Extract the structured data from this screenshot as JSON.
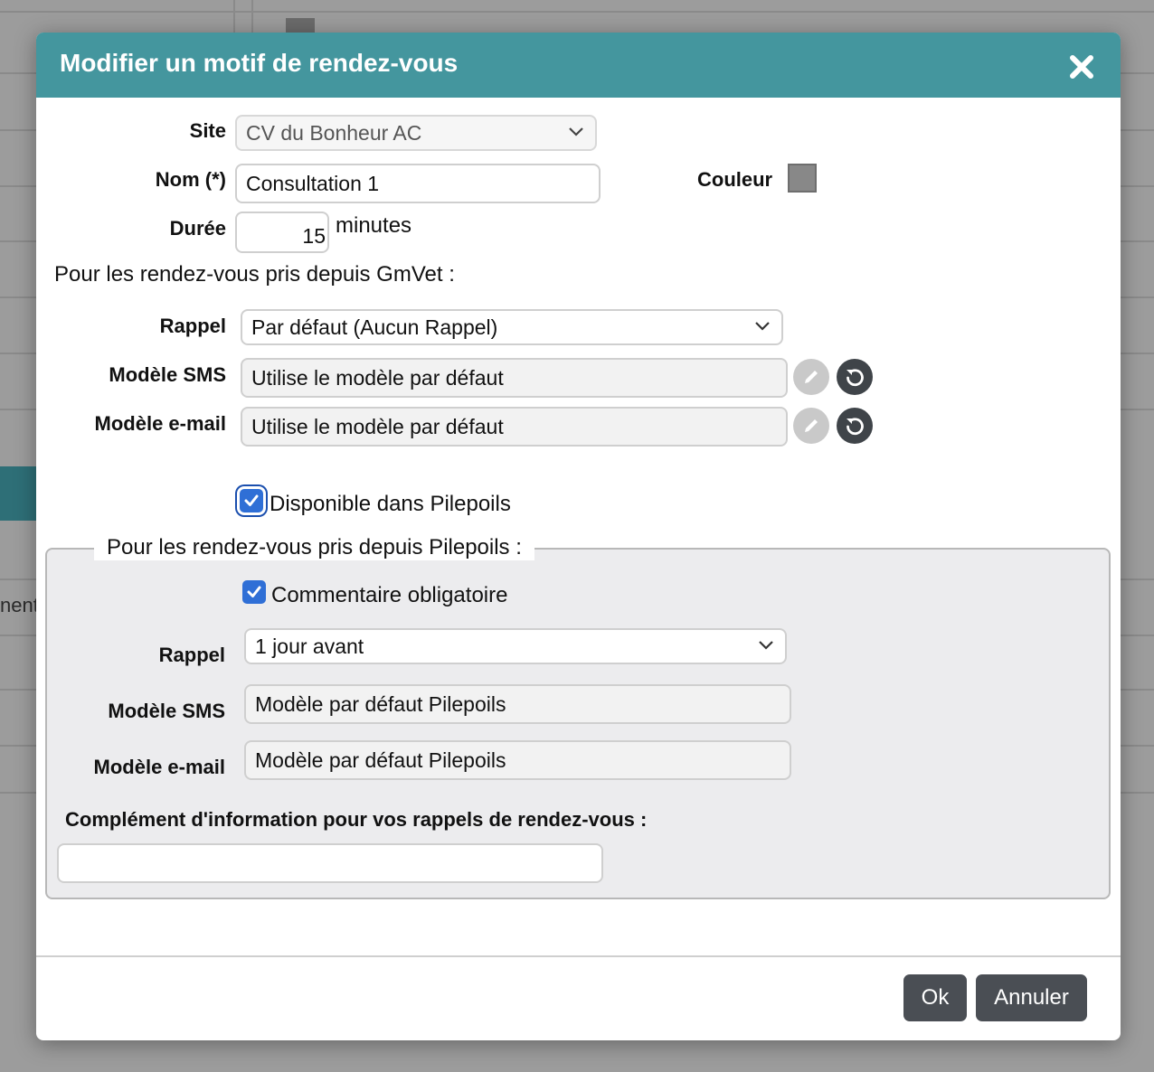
{
  "background": {
    "partial_text": "nent"
  },
  "dialog": {
    "title": "Modifier un motif de rendez-vous",
    "close_icon": "close-icon",
    "colors": {
      "header": "#44969e",
      "button": "#4a4e54",
      "checkbox": "#2f6fd6",
      "swatch": "#888888"
    }
  },
  "form": {
    "site_label": "Site",
    "site_value": "CV du Bonheur AC",
    "name_label": "Nom (*)",
    "name_value": "Consultation 1",
    "color_label": "Couleur",
    "duration_label": "Durée",
    "duration_value": "15",
    "duration_unit": "minutes",
    "gmvet_heading": "Pour les rendez-vous pris depuis GmVet :",
    "gmvet": {
      "rappel_label": "Rappel",
      "rappel_value": "Par défaut (Aucun Rappel)",
      "sms_label": "Modèle SMS",
      "sms_value": "Utilise le modèle par défaut",
      "email_label": "Modèle e-mail",
      "email_value": "Utilise le modèle par défaut"
    },
    "pilepoils_checkbox_label": "Disponible dans Pilepoils",
    "pilepoils_checked": true,
    "pilepoils": {
      "legend": "Pour les rendez-vous pris depuis Pilepoils :",
      "comment_checkbox_label": "Commentaire obligatoire",
      "comment_checked": true,
      "rappel_label": "Rappel",
      "rappel_value": "1 jour avant",
      "sms_label": "Modèle SMS",
      "sms_value": "Modèle par défaut Pilepoils",
      "email_label": "Modèle e-mail",
      "email_value": "Modèle par défaut Pilepoils",
      "complement_label": "Complément d'information pour vos rappels de rendez-vous :",
      "complement_value": ""
    }
  },
  "footer": {
    "ok_label": "Ok",
    "cancel_label": "Annuler"
  }
}
